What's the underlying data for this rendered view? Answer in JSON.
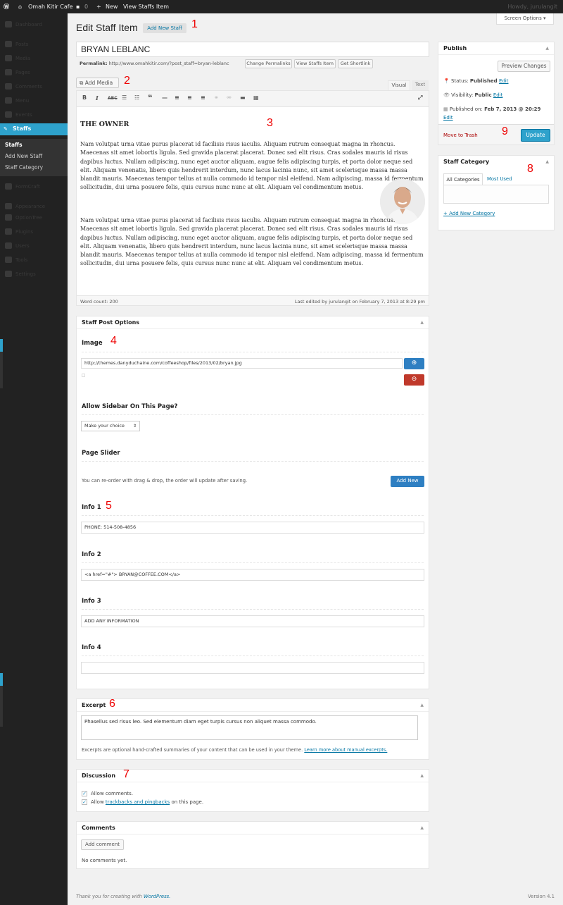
{
  "admin_bar": {
    "site_name": "Omah Kitir Cafe",
    "comments_count": "0",
    "new_label": "New",
    "view_label": "View Staffs Item",
    "howdy": "Howdy, jurulangit"
  },
  "sidebar": {
    "items": [
      {
        "label": "Dashboard"
      },
      {
        "label": "Posts"
      },
      {
        "label": "Media"
      },
      {
        "label": "Pages"
      },
      {
        "label": "Comments"
      },
      {
        "label": "Menu"
      },
      {
        "label": "Events"
      },
      {
        "label": "Staffs"
      },
      {
        "label": "FormCraft"
      },
      {
        "label": "Appearance"
      },
      {
        "label": "OptionTree"
      },
      {
        "label": "Plugins"
      },
      {
        "label": "Users"
      },
      {
        "label": "Tools"
      },
      {
        "label": "Settings"
      }
    ],
    "staff_submenu": [
      "Staffs",
      "Add New Staff",
      "Staff Category"
    ]
  },
  "header": {
    "title": "Edit Staff Item",
    "add_new": "Add New Staff",
    "screen_options": "Screen Options ▾"
  },
  "post": {
    "title": "BRYAN LEBLANC",
    "permalink_label": "Permalink:",
    "permalink_url": "http://www.omahkitir.com/?post_staff=bryan-leblanc",
    "permalink_buttons": [
      "Change Permalinks",
      "View Staffs Item",
      "Get Shortlink"
    ]
  },
  "editor": {
    "add_media": "Add Media",
    "tab_visual": "Visual",
    "tab_text": "Text",
    "heading": "THE OWNER",
    "paragraph1": "Nam volutpat urna vitae purus placerat id facilisis risus iaculis. Aliquam rutrum consequat magna in rhoncus. Maecenas sit amet lobortis ligula. Sed gravida placerat placerat. Donec sed elit risus. Cras sodales mauris id risus dapibus luctus. Nullam adipiscing, nunc eget auctor aliquam, augue felis adipiscing turpis, et porta dolor neque sed elit. Aliquam venenatis, libero quis hendrerit interdum, nunc lacus lacinia nunc, sit amet scelerisque massa massa blandit mauris. Maecenas tempor tellus at nulla commodo id tempor nisl eleifend. Nam adipiscing, massa id fermentum sollicitudin, dui urna posuere felis, quis cursus nunc nunc at elit. Aliquam vel condimentum metus.",
    "paragraph2": "Nam volutpat urna vitae purus placerat id facilisis risus iaculis. Aliquam rutrum consequat magna in rhoncus. Maecenas sit amet lobortis ligula. Sed gravida placerat placerat. Donec sed elit risus. Cras sodales mauris id risus dapibus luctus. Nullam adipiscing, nunc eget auctor aliquam, augue felis adipiscing turpis, et porta dolor neque sed elit. Aliquam venenatis, libero quis hendrerit interdum, nunc lacus lacinia nunc, sit amet scelerisque massa massa blandit mauris. Maecenas tempor tellus at nulla commodo id tempor nisl eleifend. Nam adipiscing, massa id fermentum sollicitudin, dui urna posuere felis, quis cursus nunc nunc at elit. Aliquam vel condimentum metus.",
    "word_count": "Word count: 200",
    "last_edited": "Last edited by jurulangit on February 7, 2013 at 8:29 pm"
  },
  "staff_options": {
    "title": "Staff Post Options",
    "image_label": "Image",
    "image_url": "http://themes.danyduchaine.com/coffeeshop/files/2013/02/bryan.jpg",
    "sidebar_label": "Allow Sidebar On This Page?",
    "sidebar_select": "Make your choice",
    "slider_label": "Page Slider",
    "slider_hint": "You can re-order with drag & drop, the order will update after saving.",
    "add_new": "Add New",
    "info1_label": "Info 1",
    "info1_value": "PHONE: 514-508-4856",
    "info2_label": "Info 2",
    "info2_value": "<a href=\"#\"> BRYAN@COFFEE.COM</a>",
    "info3_label": "Info 3",
    "info3_value": "ADD ANY INFORMATION",
    "info4_label": "Info 4",
    "info4_value": ""
  },
  "excerpt": {
    "title": "Excerpt",
    "text": "Phasellus sed risus leo. Sed elementum diam eget turpis cursus non aliquet massa commodo.",
    "help": "Excerpts are optional hand-crafted summaries of your content that can be used in your theme.",
    "help_link": "Learn more about manual excerpts."
  },
  "discussion": {
    "title": "Discussion",
    "allow_comments": "Allow comments.",
    "allow_pre": "Allow",
    "allow_link": "trackbacks and pingbacks",
    "allow_post": "on this page."
  },
  "comments": {
    "title": "Comments",
    "add_button": "Add comment",
    "none": "No comments yet."
  },
  "publish": {
    "title": "Publish",
    "preview": "Preview Changes",
    "status_label": "Status:",
    "status_value": "Published",
    "visibility_label": "Visibility:",
    "visibility_value": "Public",
    "published_label": "Published on:",
    "published_value": "Feb 7, 2013 @ 20:29",
    "edit": "Edit",
    "trash": "Move to Trash",
    "update": "Update"
  },
  "category": {
    "title": "Staff Category",
    "tab_all": "All Categories",
    "tab_used": "Most Used",
    "add_new": "+ Add New Category"
  },
  "footer": {
    "thanks_pre": "Thank you for creating with",
    "wordpress": "WordPress.",
    "version": "Version 4.1"
  },
  "annotations": [
    "1",
    "2",
    "3",
    "4",
    "5",
    "6",
    "7",
    "8",
    "9"
  ],
  "colors": {
    "accent": "#2ea2cc",
    "trash": "#a00",
    "sidebar": "#222",
    "annotation": "#e00"
  }
}
